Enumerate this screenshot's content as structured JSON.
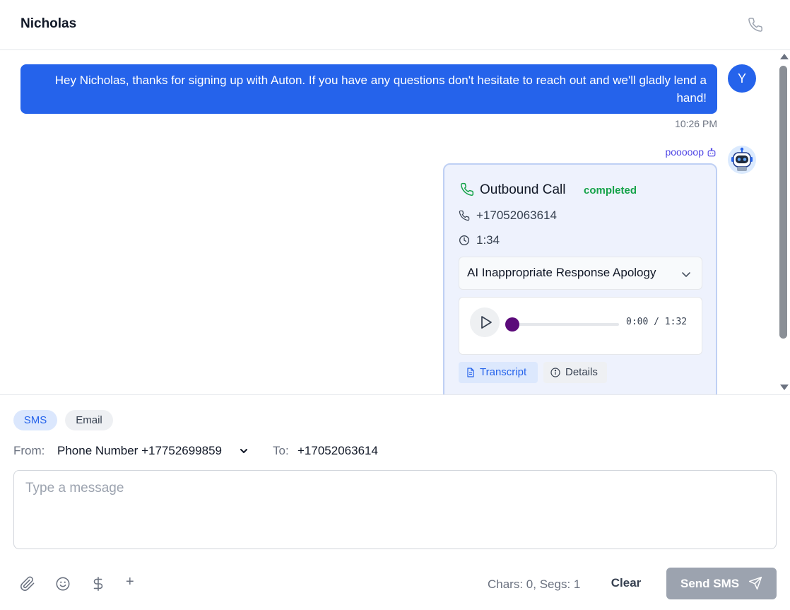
{
  "header": {
    "contact_name": "Nicholas",
    "call_icon": "phone-icon"
  },
  "conversation": {
    "outgoing_message": {
      "text": "Hey Nicholas, thanks for signing up with Auton. If you have any questions don't hesitate to reach out and we'll gladly lend a hand!",
      "avatar_initial": "Y",
      "timestamp": "10:26 PM"
    },
    "call_log": {
      "sender": "pooooop",
      "sender_icon": "bot-icon",
      "avatar": "robot-avatar",
      "title": "Outbound Call",
      "status": "completed",
      "phone_number": "+17052063614",
      "duration": "1:34",
      "summary_title": "AI Inappropriate Response Apology",
      "audio": {
        "time_readout": "0:00 / 1:32",
        "progress_fraction": 0
      },
      "transcript_label": "Transcript",
      "details_label": "Details"
    }
  },
  "composer": {
    "channels": [
      "SMS",
      "Email"
    ],
    "active_channel": "SMS",
    "from_label": "From:",
    "from_value": "Phone Number +17752699859",
    "to_label": "To:",
    "to_value": "+17052063614",
    "message_placeholder": "Type a message",
    "message_value": "",
    "tools": [
      "paperclip-icon",
      "smiley-icon",
      "dollar-icon",
      "plus-icon"
    ],
    "plus_label": "+",
    "counter": "Chars: 0, Segs: 1",
    "clear_label": "Clear",
    "send_label": "Send SMS"
  },
  "colors": {
    "accent": "#2563eb",
    "status_completed": "#16a34a",
    "sender_name": "#4f46e5",
    "audio_knob": "#5b0a7a",
    "send_disabled": "#9ca3af"
  }
}
